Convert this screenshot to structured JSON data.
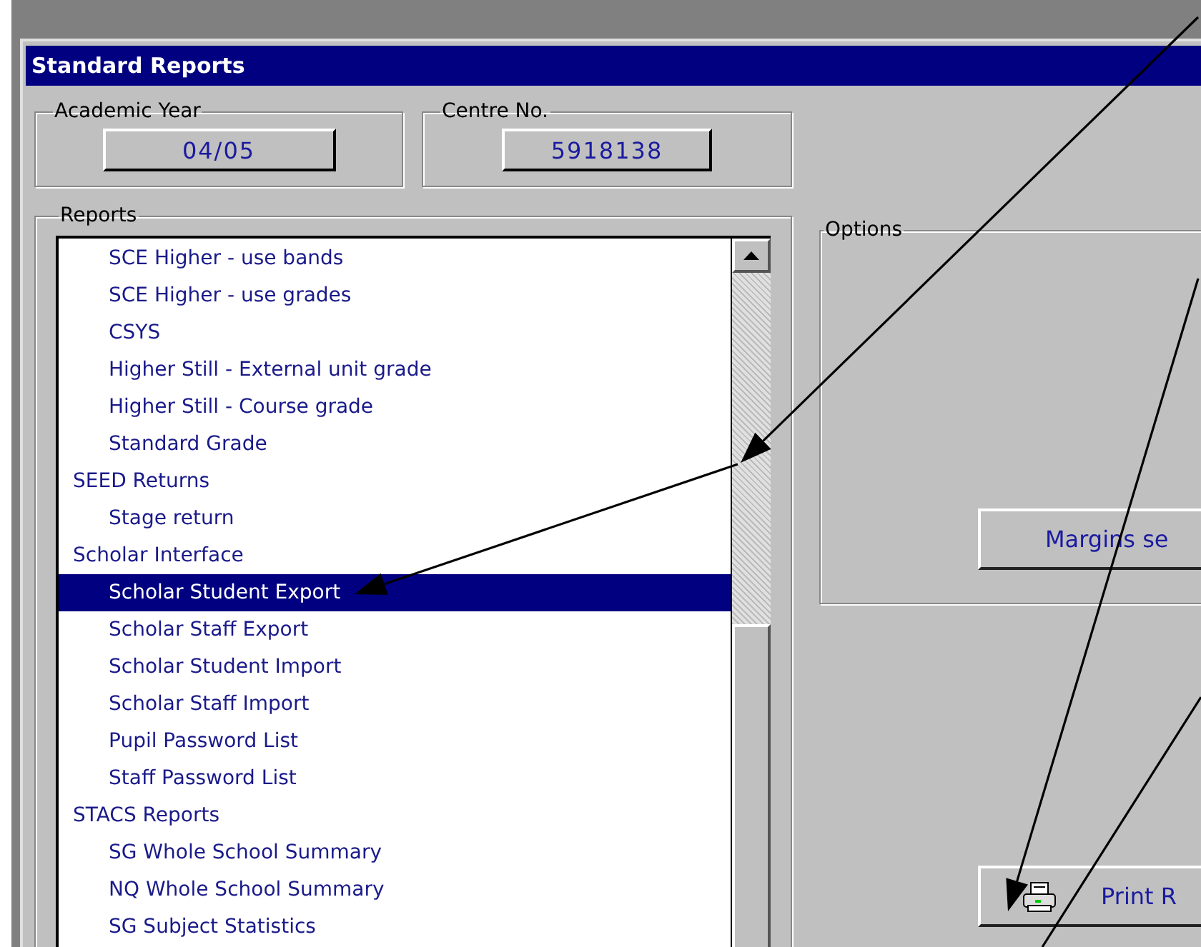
{
  "window": {
    "title": "Standard Reports"
  },
  "academic_year": {
    "label": "Academic Year",
    "value": "04/05"
  },
  "centre": {
    "label": "Centre No.",
    "value": "5918138"
  },
  "reports": {
    "label": "Reports",
    "items": [
      {
        "children": [
          {
            "label": "SCE Higher - use bands",
            "selected": false
          },
          {
            "label": "SCE Higher - use grades",
            "selected": false
          },
          {
            "label": "CSYS",
            "selected": false
          },
          {
            "label": "Higher Still - External unit grade",
            "selected": false
          },
          {
            "label": "Higher Still - Course grade",
            "selected": false
          },
          {
            "label": "Standard Grade",
            "selected": false
          }
        ]
      },
      {
        "label": "SEED Returns",
        "selected": false,
        "children": [
          {
            "label": "Stage return",
            "selected": false
          }
        ]
      },
      {
        "label": "Scholar Interface",
        "selected": false,
        "children": [
          {
            "label": "Scholar Student Export",
            "selected": true
          },
          {
            "label": "Scholar Staff Export",
            "selected": false
          },
          {
            "label": "Scholar Student Import",
            "selected": false
          },
          {
            "label": "Scholar Staff Import",
            "selected": false
          },
          {
            "label": "Pupil Password List",
            "selected": false
          },
          {
            "label": "Staff Password List",
            "selected": false
          }
        ]
      },
      {
        "label": "STACS Reports",
        "selected": false,
        "children": [
          {
            "label": "SG Whole School Summary",
            "selected": false
          },
          {
            "label": "NQ Whole School Summary",
            "selected": false
          },
          {
            "label": "SG Subject Statistics",
            "selected": false
          }
        ]
      }
    ]
  },
  "options": {
    "label": "Options",
    "margins_button": "Margins se"
  },
  "print_button": "Print R"
}
